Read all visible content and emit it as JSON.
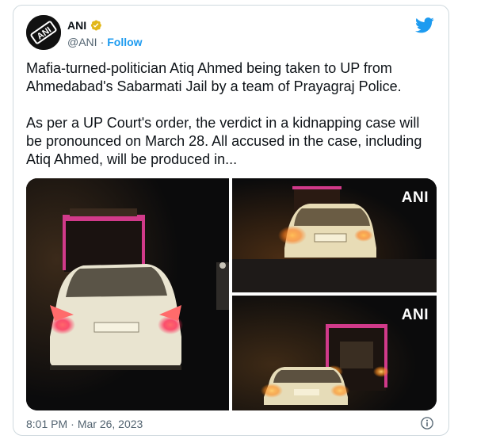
{
  "tweet": {
    "author_name": "ANI",
    "handle": "@ANI",
    "separator": "·",
    "follow_label": "Follow",
    "avatar_text": "ANI",
    "paragraphs": [
      "Mafia-turned-politician Atiq Ahmed being taken to UP from Ahmedabad's Sabarmati Jail by a team of Prayagraj Police.",
      "As per a UP Court's order, the verdict in a kidnapping case will be pronounced on March 28. All accused in the case, including Atiq Ahmed, will be produced in..."
    ],
    "media": {
      "watermark_top_right": "ANI",
      "watermark_bottom_right": "ANI"
    },
    "time": "8:01 PM",
    "date": "Mar 26, 2023"
  },
  "colors": {
    "accent": "#1d9bf0",
    "text": "#0f1419",
    "muted": "#536471",
    "border": "#cfd9de",
    "verified": "#e2b719"
  },
  "icons": {
    "platform": "twitter-bird-icon",
    "verified": "verified-badge-icon",
    "info": "info-icon"
  }
}
